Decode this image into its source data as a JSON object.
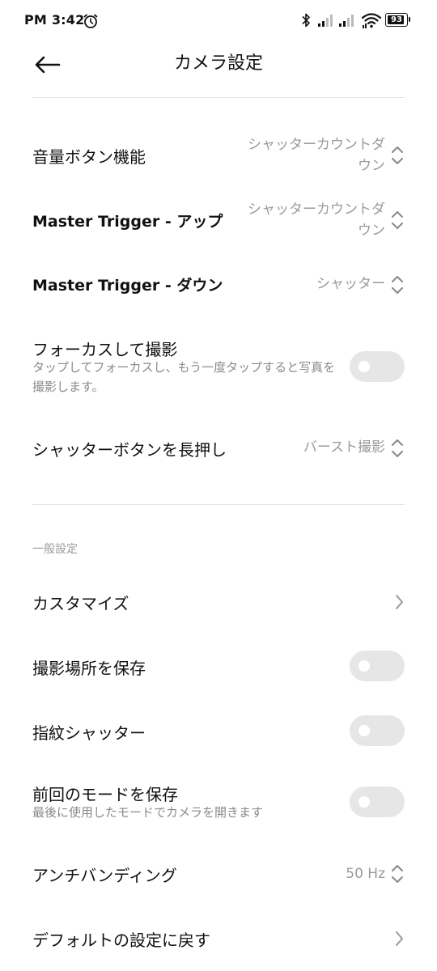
{
  "status_bar": {
    "time": "PM 3:42",
    "battery": "93",
    "battery_level": 0.93
  },
  "header": {
    "title": "カメラ設定"
  },
  "rows": {
    "volume_button": {
      "title": "音量ボタン機能",
      "value_line1": "シャッターカウントダ",
      "value_line2": "ウン"
    },
    "master_up": {
      "title": "Master Trigger - アップ",
      "value_line1": "シャッターカウントダ",
      "value_line2": "ウン"
    },
    "master_down": {
      "title": "Master Trigger - ダウン",
      "value": "シャッター"
    },
    "focus_shoot": {
      "title": "フォーカスして撮影",
      "subtitle": "タップしてフォーカスし、もう一度タップすると写真を撮影します。",
      "enabled": false
    },
    "long_press": {
      "title": "シャッターボタンを長押し",
      "value": "バースト撮影"
    }
  },
  "general": {
    "section_title": "一般設定",
    "customize": {
      "title": "カスタマイズ"
    },
    "save_location": {
      "title": "撮影場所を保存",
      "enabled": false
    },
    "fingerprint": {
      "title": "指紋シャッター",
      "enabled": false
    },
    "save_mode": {
      "title": "前回のモードを保存",
      "subtitle": "最後に使用したモードでカメラを開きます",
      "enabled": false
    },
    "antibanding": {
      "title": "アンチバンディング",
      "value": "50 Hz"
    },
    "reset": {
      "title": "デフォルトの設定に戻す"
    }
  }
}
